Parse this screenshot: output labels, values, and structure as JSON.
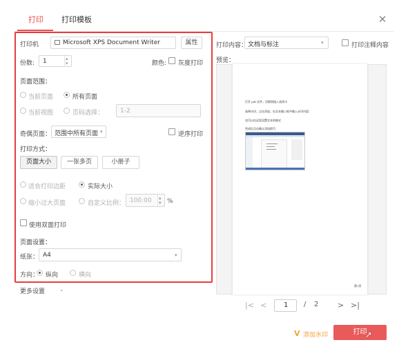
{
  "tabs": {
    "print": "打印",
    "template": "打印模板"
  },
  "printer": {
    "label": "打印机",
    "value": "Microsoft XPS Document Writer",
    "properties": "属性"
  },
  "copies": {
    "label": "份数:",
    "value": "1"
  },
  "color": {
    "label": "颜色:",
    "grayscale": "灰度打印"
  },
  "range": {
    "title": "页面范围：",
    "current_page": "当前页面",
    "all_pages": "所有页面",
    "current_view": "当前视图",
    "page_select": "页码选择：",
    "page_placeholder": "1-2"
  },
  "odd_even": {
    "label": "奇偶页面：",
    "value": "范围中所有页面",
    "reverse": "逆序打印"
  },
  "mode": {
    "title": "打印方式：",
    "buttons": [
      "页面大小",
      "一张多页",
      "小册子"
    ]
  },
  "scale": {
    "fit_margin": "适合打印边距",
    "actual_size": "实际大小",
    "shrink": "缩小过大页面",
    "custom": "自定义比例：",
    "custom_value": "100.00",
    "percent": "%"
  },
  "duplex": {
    "label": "使用双面打印"
  },
  "page_setup": {
    "title": "页面设置：",
    "paper_label": "纸张：",
    "paper_value": "A4"
  },
  "orientation": {
    "label": "方向：",
    "portrait": "纵向",
    "landscape": "横向"
  },
  "more_settings": "更多设置",
  "content": {
    "label": "打印内容：",
    "value": "文档与标注",
    "annotations": "打印注释内容"
  },
  "preview": {
    "label": "预览：",
    "lines": [
      "打开 pdf 文件，切换到插入选项卡",
      "选择水印，点击添加，在文本输入框中输入水印内容：",
      "也可以在这里设置文本的格式",
      "完成后点击确认添加即可"
    ],
    "page_label": "第1页"
  },
  "pager": {
    "current": "1",
    "separator": "/",
    "total": "2"
  },
  "add_watermark": "添加水印",
  "print_button": "打印",
  "colors": {
    "accent": "#e94b4b",
    "print_button": "#e95a5a",
    "watermark_link": "#f5a23c"
  }
}
